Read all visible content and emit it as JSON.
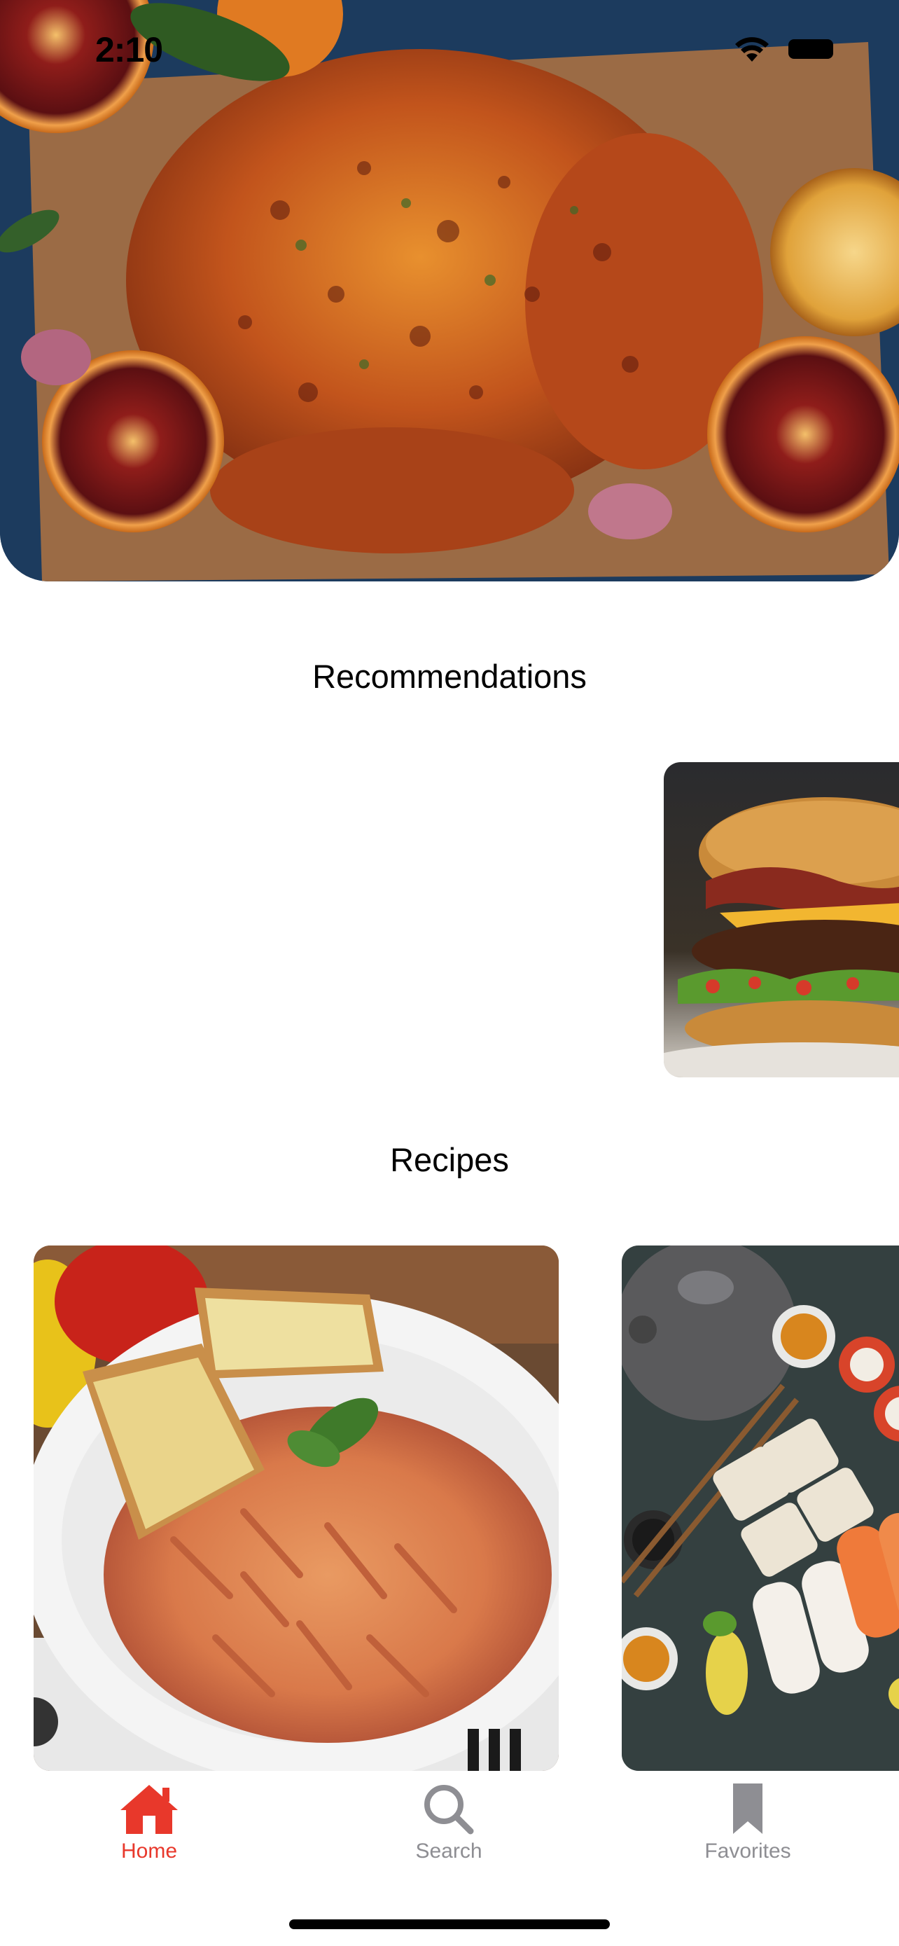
{
  "status_bar": {
    "time": "2:10",
    "wifi_icon": "wifi-icon",
    "battery_icon": "battery-icon"
  },
  "hero": {
    "image": "roast-chicken-with-blood-oranges"
  },
  "recommendations": {
    "title": "Recommendations",
    "items": [
      {
        "image": "burger"
      }
    ]
  },
  "recipes": {
    "title": "Recipes",
    "items": [
      {
        "image": "pasta-with-garlic-bread"
      },
      {
        "image": "sushi-platter"
      }
    ]
  },
  "tab_bar": {
    "active_color": "#e8382b",
    "inactive_color": "#8e8e93",
    "tabs": [
      {
        "label": "Home",
        "icon": "home-icon",
        "active": true
      },
      {
        "label": "Search",
        "icon": "search-icon",
        "active": false
      },
      {
        "label": "Favorites",
        "icon": "bookmark-icon",
        "active": false
      }
    ]
  }
}
